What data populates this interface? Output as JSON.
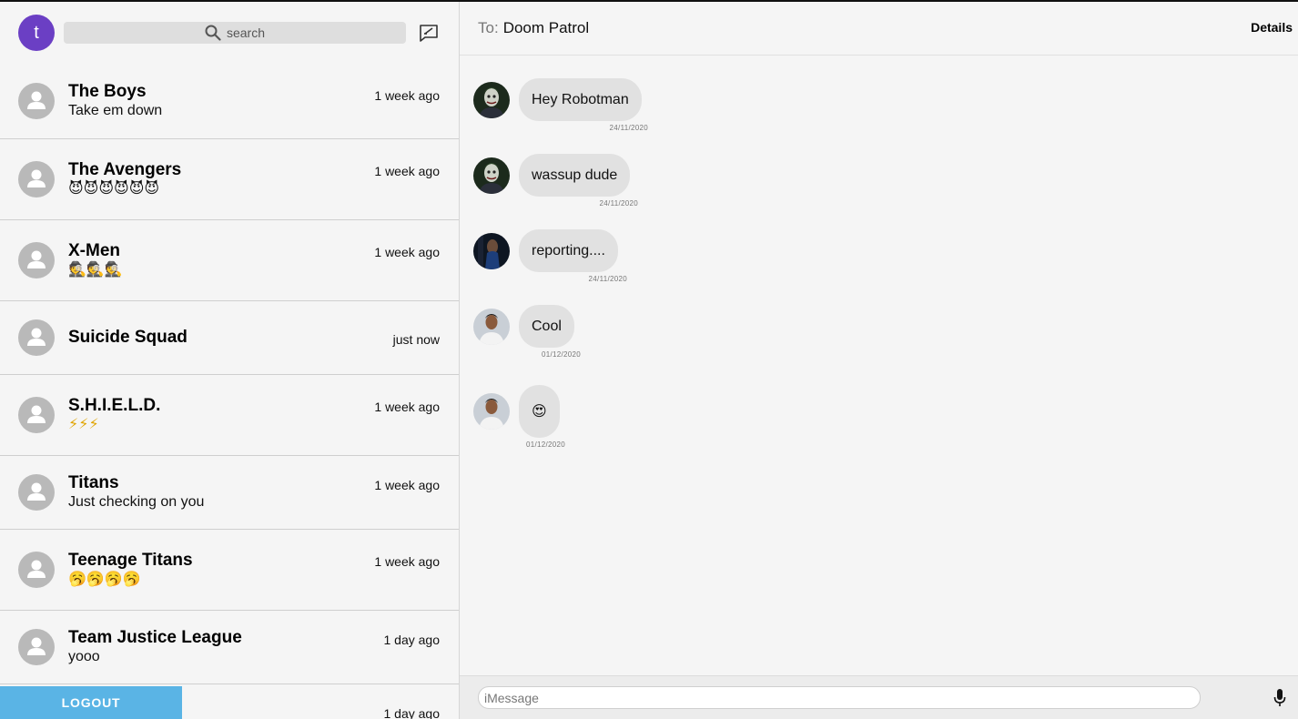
{
  "user": {
    "initial": "t"
  },
  "search": {
    "placeholder": "search"
  },
  "conversations": [
    {
      "name": "The Boys",
      "last": "Take em down",
      "time": "1 week ago"
    },
    {
      "name": "The Avengers",
      "last": "😈😈😈😈😈😈",
      "time": "1 week ago"
    },
    {
      "name": "X-Men",
      "last": "🕵🕵🕵",
      "time": "1 week ago"
    },
    {
      "name": "Suicide Squad",
      "last": "",
      "time": "just now"
    },
    {
      "name": "S.H.I.E.L.D.",
      "last": "⚡⚡⚡",
      "time": "1 week ago"
    },
    {
      "name": "Titans",
      "last": "Just checking on you",
      "time": "1 week ago"
    },
    {
      "name": "Teenage Titans",
      "last": "🥱🥱🥱🥱",
      "time": "1 week ago"
    },
    {
      "name": "Team Justice League",
      "last": "yooo",
      "time": "1 day ago"
    },
    {
      "name": "",
      "last": "",
      "time": "1 day ago"
    }
  ],
  "logout_label": "LOGOUT",
  "chat": {
    "to_label": "To:",
    "to_name": "Doom Patrol",
    "details_label": "Details",
    "messages": [
      {
        "text": "Hey Robotman",
        "date": "24/11/2020"
      },
      {
        "text": "wassup dude",
        "date": "24/11/2020"
      },
      {
        "text": "reporting....",
        "date": "24/11/2020"
      },
      {
        "text": "Cool",
        "date": "01/12/2020"
      },
      {
        "text": "😍",
        "date": "01/12/2020"
      }
    ],
    "input_placeholder": "iMessage"
  },
  "colors": {
    "user_avatar": "#6b3fc4",
    "logout_button": "#5ab4e5",
    "bubble": "#e1e1e1",
    "background": "#f5f5f5"
  },
  "icons": {
    "search": "search-icon",
    "compose": "compose-icon",
    "person": "person-icon",
    "mic": "microphone-icon"
  }
}
